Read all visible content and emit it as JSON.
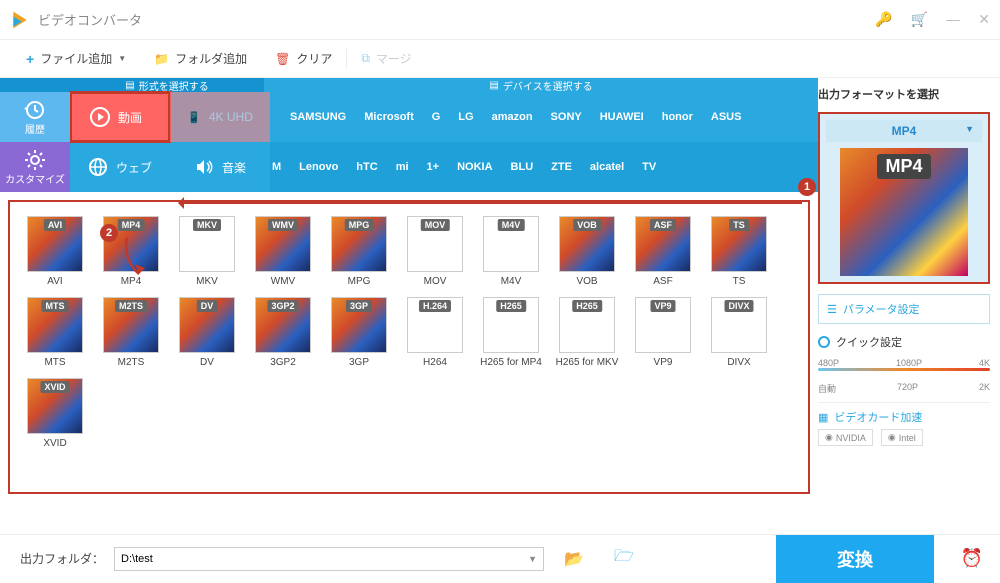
{
  "app": {
    "title": "ビデオコンバータ"
  },
  "toolbar": {
    "add_file": "ファイル追加",
    "add_folder": "フォルダ追加",
    "clear": "クリア",
    "merge": "マージ"
  },
  "tabs": {
    "format_header": "形式を選択する",
    "device_header": "デバイスを選択する"
  },
  "side": {
    "history": "履歴",
    "customize": "カスタマイズ"
  },
  "categories": {
    "video": "動画",
    "uhd": "4K UHD",
    "web": "ウェブ",
    "audio": "音楽"
  },
  "brands_row1": [
    "",
    "SAMSUNG",
    "Microsoft",
    "G",
    "LG",
    "amazon",
    "SONY",
    "HUAWEI",
    "honor",
    "ASUS"
  ],
  "brands_row2": [
    "M",
    "Lenovo",
    "hTC",
    "mi",
    "1+",
    "NOKIA",
    "BLU",
    "ZTE",
    "alcatel",
    "TV"
  ],
  "formats": [
    {
      "badge": "AVI",
      "label": "AVI"
    },
    {
      "badge": "MP4",
      "label": "MP4"
    },
    {
      "badge": "MKV",
      "label": "MKV",
      "light": true
    },
    {
      "badge": "WMV",
      "label": "WMV"
    },
    {
      "badge": "MPG",
      "label": "MPG"
    },
    {
      "badge": "MOV",
      "label": "MOV",
      "light": true
    },
    {
      "badge": "M4V",
      "label": "M4V",
      "light": true
    },
    {
      "badge": "VOB",
      "label": "VOB"
    },
    {
      "badge": "ASF",
      "label": "ASF"
    },
    {
      "badge": "TS",
      "label": "TS"
    },
    {
      "badge": "MTS",
      "label": "MTS"
    },
    {
      "badge": "M2TS",
      "label": "M2TS"
    },
    {
      "badge": "DV",
      "label": "DV"
    },
    {
      "badge": "3GP2",
      "label": "3GP2"
    },
    {
      "badge": "3GP",
      "label": "3GP"
    },
    {
      "badge": "H.264",
      "label": "H264",
      "light": true
    },
    {
      "badge": "H265",
      "label": "H265 for MP4",
      "light": true
    },
    {
      "badge": "H265",
      "label": "H265 for MKV",
      "light": true
    },
    {
      "badge": "VP9",
      "label": "VP9",
      "light": true
    },
    {
      "badge": "DIVX",
      "label": "DIVX",
      "light": true
    },
    {
      "badge": "XVID",
      "label": "XVID"
    }
  ],
  "annotations": {
    "one": "1",
    "two": "2"
  },
  "right": {
    "title": "出力フォーマットを選択",
    "selected_format": "MP4",
    "preview_badge": "MP4",
    "params": "パラメータ設定",
    "quick": "クイック設定",
    "quality_top": [
      "480P",
      "1080P",
      "4K"
    ],
    "quality_bottom": [
      "自動",
      "720P",
      "2K"
    ],
    "gpu_title": "ビデオカード加速",
    "gpu_vendors": [
      "NVIDIA",
      "Intel"
    ]
  },
  "bottom": {
    "out_label": "出力フォルダ：",
    "out_path": "D:\\test",
    "convert": "変換"
  }
}
